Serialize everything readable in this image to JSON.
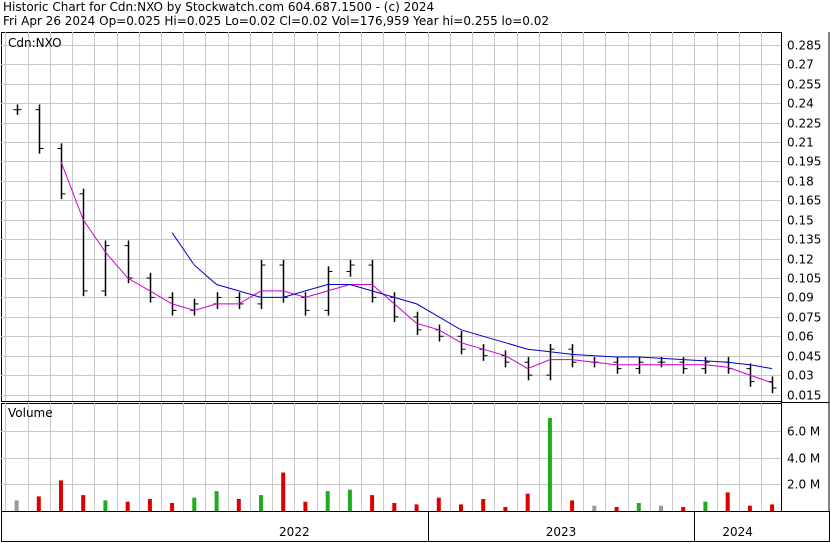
{
  "header": {
    "line1": "Historic Chart for Cdn:NXO by Stockwatch.com 604.687.1500 - (c) 2024",
    "line2": "Fri Apr 26 2024   Op=0.025   Hi=0.025   Lo=0.02   Cl=0.02   Vol=176,959   Year hi=0.255   lo=0.02"
  },
  "colors": {
    "price_bar": "#000000",
    "ma_short": "#cc00cc",
    "ma_long": "#0000cc",
    "volume_up": "#22aa22",
    "volume_down": "#dd0000",
    "volume_flat": "#999999",
    "grid": "#c8c8c8"
  },
  "chart_data": [
    {
      "type": "line",
      "title": "Cdn:NXO",
      "xlabel": "",
      "ylabel": "",
      "ylim": [
        0.01,
        0.295
      ],
      "yticks": [
        "0.285",
        "0.27",
        "0.255",
        "0.24",
        "0.225",
        "0.21",
        "0.195",
        "0.18",
        "0.165",
        "0.15",
        "0.135",
        "0.12",
        "0.105",
        "0.09",
        "0.075",
        "0.06",
        "0.045",
        "0.03",
        "0.015"
      ],
      "x_labels": [
        "2022",
        "2023",
        "2024"
      ],
      "grid": true,
      "series": [
        {
          "name": "",
          "kind": "price",
          "x": [
            "2021-06",
            "2021-07",
            "2021-08",
            "2021-09",
            "2021-10",
            "2021-11",
            "2021-12",
            "2022-01",
            "2022-02",
            "2022-03",
            "2022-04",
            "2022-05",
            "2022-06",
            "2022-07",
            "2022-08",
            "2022-09",
            "2022-10",
            "2022-11",
            "2022-12",
            "2023-01",
            "2023-02",
            "2023-03",
            "2023-04",
            "2023-05",
            "2023-06",
            "2023-07",
            "2023-08",
            "2023-09",
            "2023-10",
            "2023-11",
            "2023-12",
            "2024-01",
            "2024-02",
            "2024-03",
            "2024-04"
          ],
          "values": [
            0.235,
            0.205,
            0.17,
            0.095,
            0.13,
            0.105,
            0.09,
            0.08,
            0.085,
            0.09,
            0.085,
            0.115,
            0.09,
            0.08,
            0.11,
            0.115,
            0.09,
            0.075,
            0.065,
            0.06,
            0.05,
            0.045,
            0.04,
            0.03,
            0.05,
            0.04,
            0.04,
            0.035,
            0.04,
            0.04,
            0.035,
            0.04,
            0.035,
            0.025,
            0.02
          ]
        },
        {
          "name": "",
          "kind": "ma_short",
          "x": [
            "2021-06",
            "2021-07",
            "2021-08",
            "2021-09",
            "2021-10",
            "2021-11",
            "2021-12",
            "2022-01",
            "2022-02",
            "2022-03",
            "2022-04",
            "2022-05",
            "2022-06",
            "2022-07",
            "2022-08",
            "2022-09",
            "2022-10",
            "2022-11",
            "2022-12",
            "2023-01",
            "2023-02",
            "2023-03",
            "2023-04",
            "2023-05",
            "2023-06",
            "2023-07",
            "2023-08",
            "2023-09",
            "2023-10",
            "2023-11",
            "2023-12",
            "2024-01",
            "2024-02",
            "2024-03",
            "2024-04"
          ],
          "values": [
            null,
            null,
            0.195,
            0.15,
            0.125,
            0.105,
            0.095,
            0.085,
            0.08,
            0.085,
            0.085,
            0.095,
            0.095,
            0.09,
            0.095,
            0.1,
            0.1,
            0.085,
            0.07,
            0.065,
            0.055,
            0.05,
            0.045,
            0.035,
            0.042,
            0.042,
            0.04,
            0.038,
            0.038,
            0.038,
            0.038,
            0.038,
            0.036,
            0.03,
            0.024
          ]
        },
        {
          "name": "",
          "kind": "ma_long",
          "x": [
            "2022-01",
            "2022-02",
            "2022-03",
            "2022-04",
            "2022-05",
            "2022-06",
            "2022-07",
            "2022-08",
            "2022-09",
            "2022-10",
            "2022-11",
            "2022-12",
            "2023-01",
            "2023-02",
            "2023-03",
            "2023-04",
            "2023-05",
            "2023-06",
            "2023-07",
            "2023-08",
            "2023-09",
            "2023-10",
            "2023-11",
            "2023-12",
            "2024-01",
            "2024-02",
            "2024-03",
            "2024-04"
          ],
          "values": [
            0.14,
            0.115,
            0.1,
            0.095,
            0.09,
            0.09,
            0.095,
            0.1,
            0.1,
            0.095,
            0.09,
            0.085,
            0.075,
            0.065,
            0.06,
            0.055,
            0.05,
            0.048,
            0.046,
            0.045,
            0.044,
            0.044,
            0.043,
            0.042,
            0.041,
            0.04,
            0.038,
            0.035
          ]
        }
      ]
    },
    {
      "type": "bar",
      "title": "Volume",
      "ylim": [
        0,
        7000000
      ],
      "yticks": [
        "6.0 M",
        "4.0 M",
        "2.0 M"
      ],
      "grid": true,
      "x": [
        "2021-06",
        "2021-07",
        "2021-08",
        "2021-09",
        "2021-10",
        "2021-11",
        "2021-12",
        "2022-01",
        "2022-02",
        "2022-03",
        "2022-04",
        "2022-05",
        "2022-06",
        "2022-07",
        "2022-08",
        "2022-09",
        "2022-10",
        "2022-11",
        "2022-12",
        "2023-01",
        "2023-02",
        "2023-03",
        "2023-04",
        "2023-05",
        "2023-06",
        "2023-07",
        "2023-08",
        "2023-09",
        "2023-10",
        "2023-11",
        "2023-12",
        "2024-01",
        "2024-02",
        "2024-03",
        "2024-04"
      ],
      "values": [
        800000,
        1100000,
        2300000,
        1200000,
        800000,
        700000,
        900000,
        600000,
        1000000,
        1500000,
        900000,
        1200000,
        2900000,
        700000,
        1500000,
        1600000,
        1200000,
        600000,
        500000,
        1000000,
        500000,
        900000,
        300000,
        1300000,
        7000000,
        800000,
        400000,
        300000,
        600000,
        400000,
        300000,
        700000,
        1400000,
        400000,
        500000
      ]
    }
  ]
}
